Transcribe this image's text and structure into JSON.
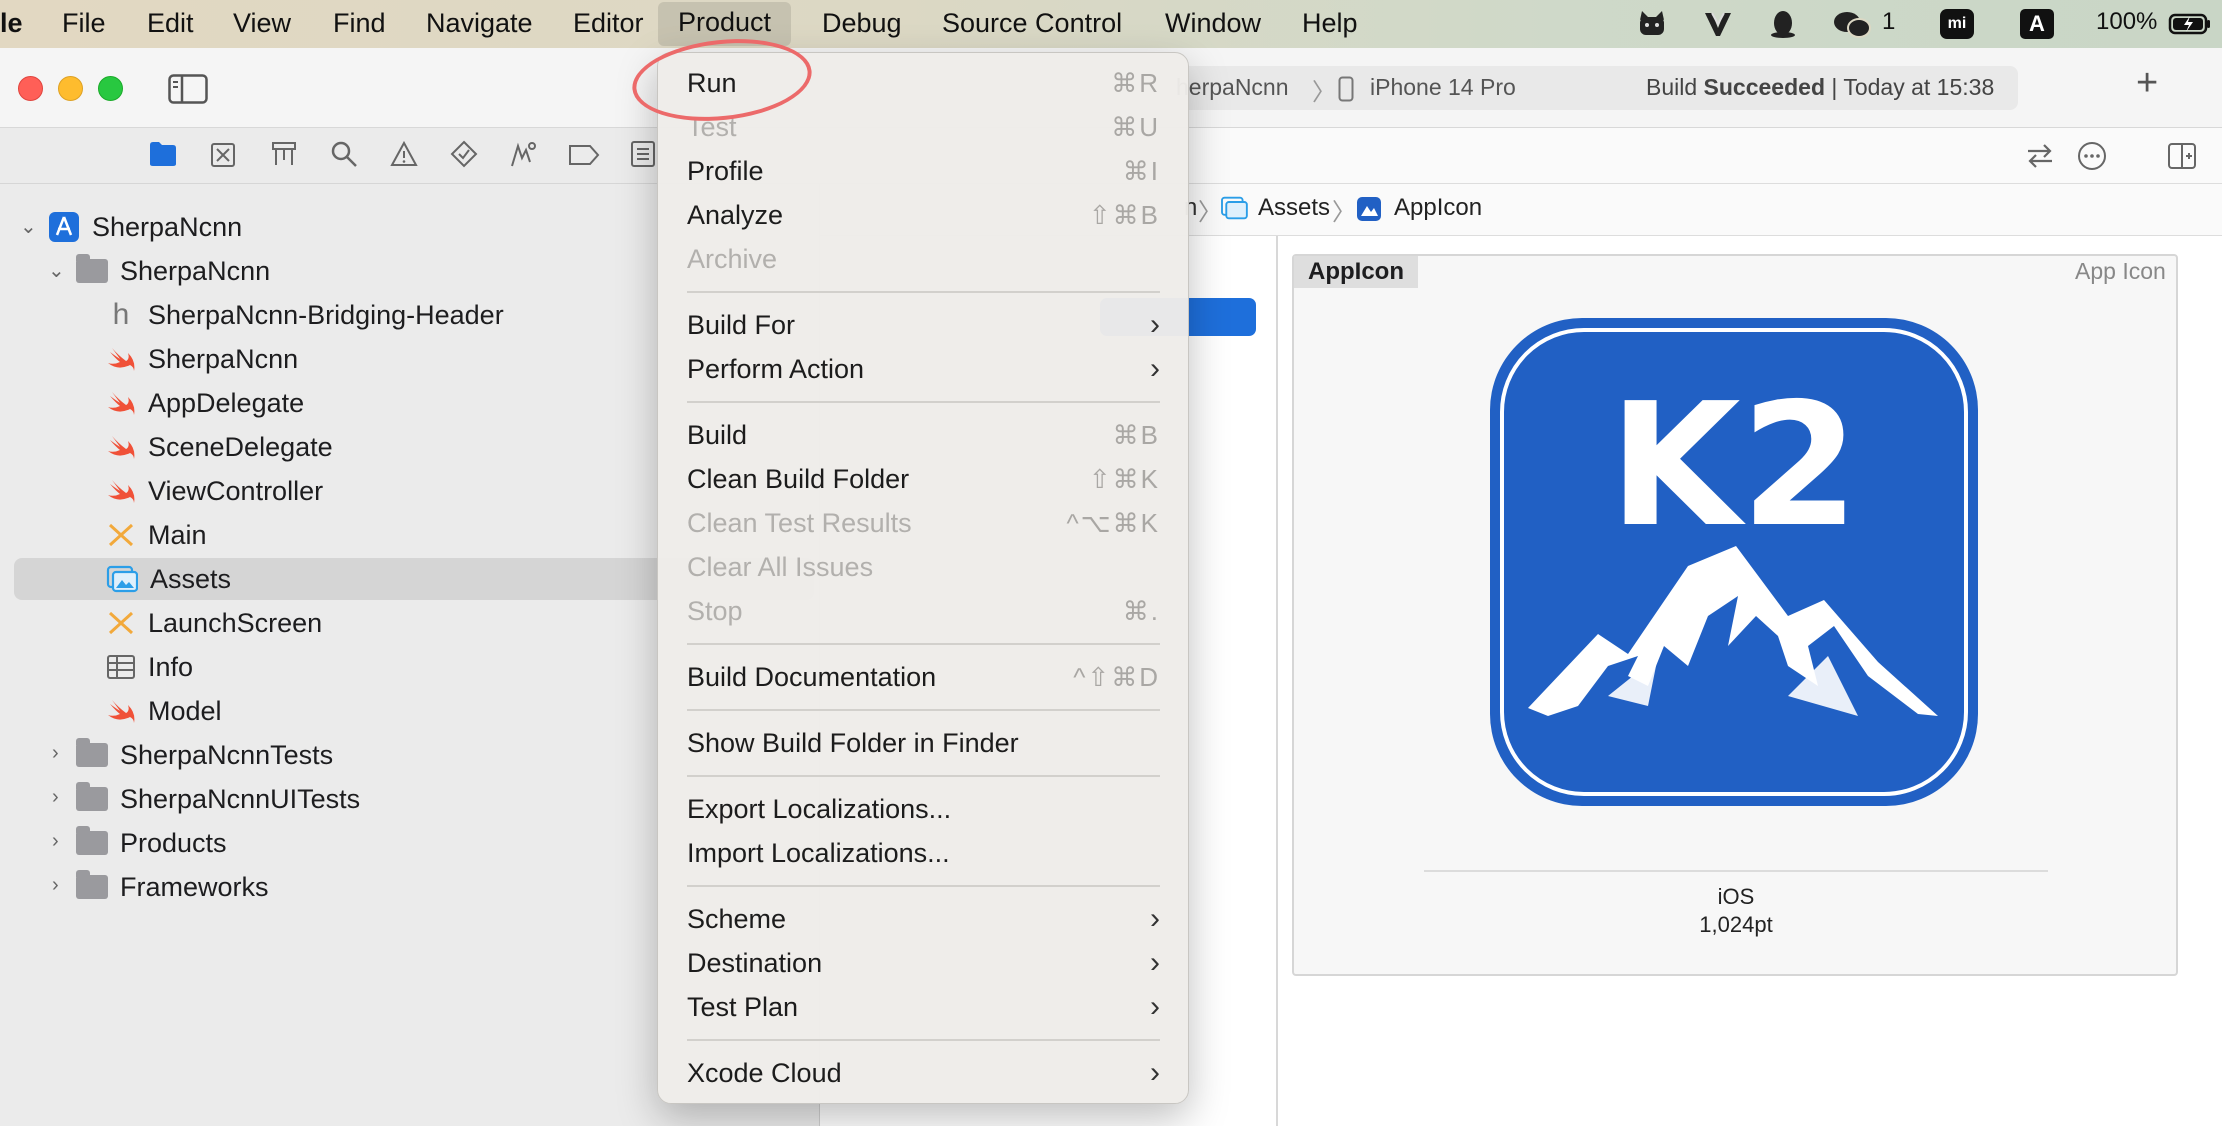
{
  "menubar": {
    "app_fragment": "le",
    "items": [
      "File",
      "Edit",
      "View",
      "Find",
      "Navigate",
      "Editor",
      "Product",
      "Debug",
      "Source Control",
      "Window",
      "Help"
    ],
    "active": "Product",
    "tray": {
      "wechat_count": "1",
      "input_badge": "A",
      "mi_badge": "mi",
      "battery": "100%"
    }
  },
  "toolbar": {
    "scheme_fragment": "herpaNcnn",
    "destination": "iPhone 14 Pro",
    "status_prefix": "Build ",
    "status_bold": "Succeeded",
    "status_suffix": " | Today at 15:38",
    "add_label": "+"
  },
  "navigator": {
    "project": "SherpaNcnn",
    "group": "SherpaNcnn",
    "files": [
      {
        "name": "SherpaNcnn-Bridging-Header",
        "type": "header"
      },
      {
        "name": "SherpaNcnn",
        "type": "swift"
      },
      {
        "name": "AppDelegate",
        "type": "swift"
      },
      {
        "name": "SceneDelegate",
        "type": "swift"
      },
      {
        "name": "ViewController",
        "type": "swift"
      },
      {
        "name": "Main",
        "type": "storyboard"
      },
      {
        "name": "Assets",
        "type": "assets",
        "selected": true
      },
      {
        "name": "LaunchScreen",
        "type": "storyboard"
      },
      {
        "name": "Info",
        "type": "plist"
      },
      {
        "name": "Model",
        "type": "swift"
      }
    ],
    "groups": [
      "SherpaNcnnTests",
      "SherpaNcnnUITests",
      "Products",
      "Frameworks"
    ]
  },
  "jumpbar": {
    "crumb_fragment": "n",
    "assets": "Assets",
    "appicon": "AppIcon"
  },
  "asset_detail": {
    "name": "AppIcon",
    "kind": "App Icon",
    "icon_text": "K2",
    "platform": "iOS",
    "size": "1,024pt"
  },
  "menu": {
    "items": [
      {
        "label": "Run",
        "shortcut": "⌘R",
        "disabled": false
      },
      {
        "label": "Test",
        "shortcut": "⌘U",
        "disabled": true
      },
      {
        "label": "Profile",
        "shortcut": "⌘I",
        "disabled": false
      },
      {
        "label": "Analyze",
        "shortcut": "⇧⌘B",
        "disabled": false
      },
      {
        "label": "Archive",
        "shortcut": "",
        "disabled": true
      },
      {
        "label": "Build For",
        "submenu": true
      },
      {
        "label": "Perform Action",
        "submenu": true
      },
      {
        "label": "Build",
        "shortcut": "⌘B",
        "disabled": false
      },
      {
        "label": "Clean Build Folder",
        "shortcut": "⇧⌘K",
        "disabled": false
      },
      {
        "label": "Clean Test Results",
        "shortcut": "^⌥⌘K",
        "disabled": true
      },
      {
        "label": "Clear All Issues",
        "shortcut": "",
        "disabled": true
      },
      {
        "label": "Stop",
        "shortcut": "⌘.",
        "disabled": true
      },
      {
        "label": "Build Documentation",
        "shortcut": "^⇧⌘D",
        "disabled": false
      },
      {
        "label": "Show Build Folder in Finder",
        "shortcut": "",
        "disabled": false
      },
      {
        "label": "Export Localizations...",
        "shortcut": "",
        "disabled": false
      },
      {
        "label": "Import Localizations...",
        "shortcut": "",
        "disabled": false
      },
      {
        "label": "Scheme",
        "submenu": true
      },
      {
        "label": "Destination",
        "submenu": true
      },
      {
        "label": "Test Plan",
        "submenu": true
      },
      {
        "label": "Xcode Cloud",
        "submenu": true
      }
    ]
  },
  "colors": {
    "accent": "#1e6fdb",
    "swift": "#f05138",
    "annotation": "#ec6a6a",
    "icon_bg": "#2160c4"
  }
}
